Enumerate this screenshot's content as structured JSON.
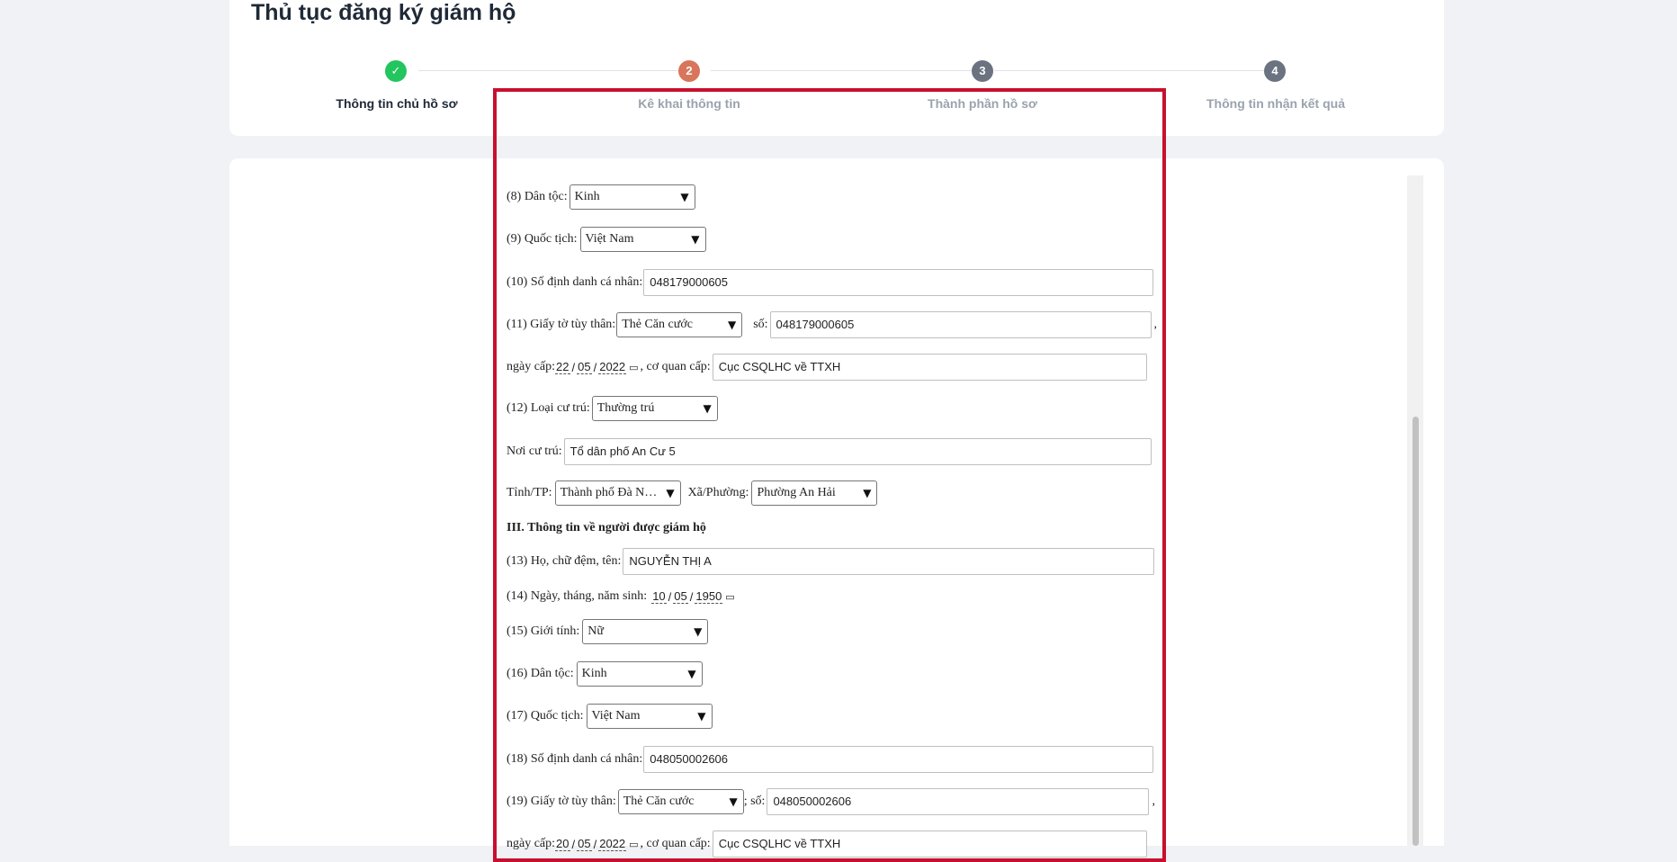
{
  "page_title": "Thủ tục đăng ký giám hộ",
  "steps": [
    {
      "number": "✓",
      "label": "Thông tin chủ hồ sơ",
      "state": "done",
      "color": "#22c55e"
    },
    {
      "number": "2",
      "label": "Kê khai thông tin",
      "state": "active",
      "color": "#d9755a"
    },
    {
      "number": "3",
      "label": "Thành phần hồ sơ",
      "state": "todo",
      "color": "#6b7280"
    },
    {
      "number": "4",
      "label": "Thông tin nhận kết quả",
      "state": "todo",
      "color": "#6b7280"
    }
  ],
  "form": {
    "ethnicity_label": "(8) Dân tộc:",
    "ethnicity_value": "Kinh",
    "nationality_label": "(9) Quốc tịch:",
    "nationality_value": "Việt Nam",
    "id_number_label": "(10) Số định danh cá nhân:",
    "id_number_value": "048179000605",
    "id_doc_label": "(11) Giấy tờ tùy thân:",
    "id_doc_type": "Thẻ Căn cước",
    "id_doc_no_label": "số:",
    "id_doc_no_value": "048179000605",
    "trailing_comma": ",",
    "issue_date_label": "ngày cấp:",
    "issue_date": {
      "d": "22",
      "m": "05",
      "y": "2022"
    },
    "issuer_label": ", cơ quan cấp:",
    "issuer_value": "Cục CSQLHC về TTXH",
    "residence_type_label": "(12) Loại cư trú:",
    "residence_type_value": "Thường trú",
    "residence_place_label": "Nơi cư trú:",
    "residence_place_value": "Tổ dân phố An Cư 5",
    "province_label": "Tỉnh/TP:",
    "province_value": "Thành phố Đà N…",
    "ward_label": "Xã/Phường:",
    "ward_value": "Phường An Hải",
    "section3_title": "III. Thông tin về người được giám hộ",
    "ward_name_label": "(13) Họ, chữ đệm, tên:",
    "ward_name_value": "NGUYỄN THỊ A",
    "dob_label": "(14) Ngày, tháng, năm sinh:",
    "dob": {
      "d": "10",
      "m": "05",
      "y": "1950"
    },
    "gender_label": "(15) Giới tính:",
    "gender_value": "Nữ",
    "ward_ethnicity_label": "(16) Dân tộc:",
    "ward_ethnicity_value": "Kinh",
    "ward_nationality_label": "(17) Quốc tịch:",
    "ward_nationality_value": "Việt Nam",
    "ward_id_number_label": "(18) Số định danh cá nhân:",
    "ward_id_number_value": "048050002606",
    "ward_id_doc_label": "(19) Giấy tờ tùy thân:",
    "ward_id_doc_type": "Thẻ Căn cước",
    "ward_id_doc_no_label": "; số:",
    "ward_id_doc_no_value": "048050002606",
    "ward_issue_date_label": "ngày cấp:",
    "ward_issue_date": {
      "d": "20",
      "m": "05",
      "y": "2022"
    },
    "ward_issuer_label": ", cơ quan cấp:",
    "ward_issuer_value": "Cục CSQLHC về TTXH"
  },
  "icons": {
    "dropdown": "▼",
    "calendar": "▭"
  },
  "highlight_color": "#c8102e"
}
